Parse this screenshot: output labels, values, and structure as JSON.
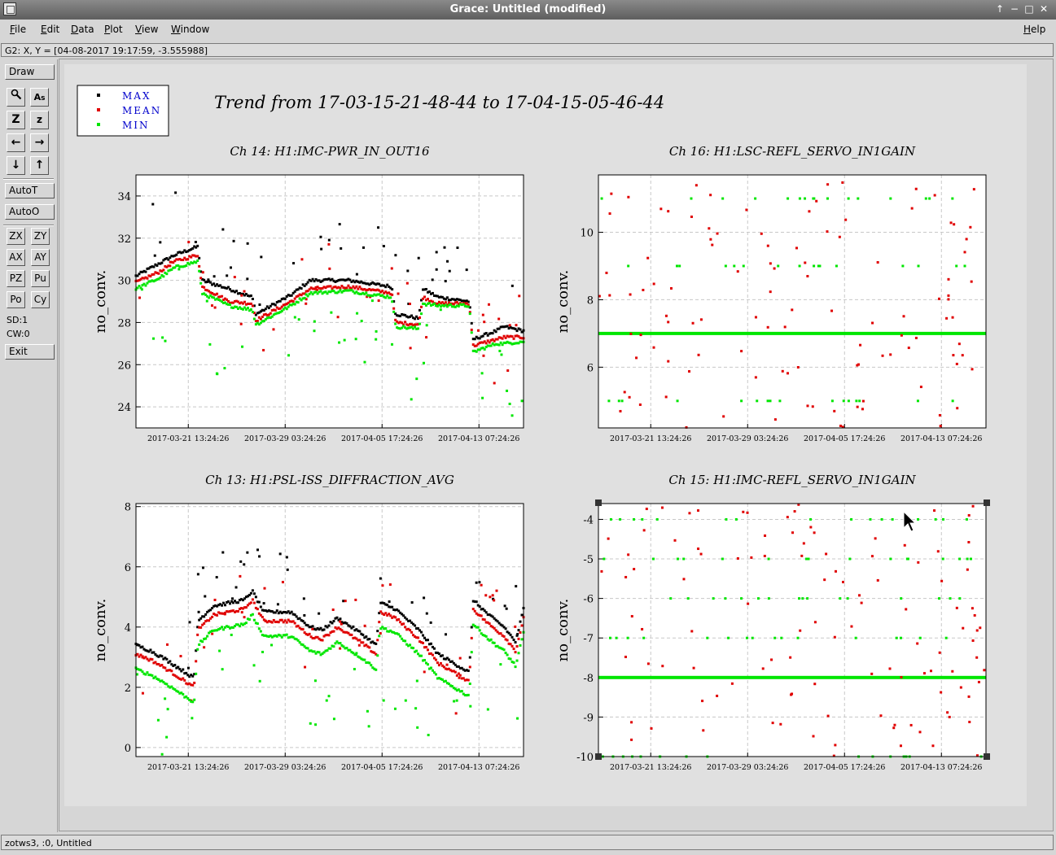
{
  "window": {
    "title": "Grace: Untitled (modified)"
  },
  "menubar": {
    "file": "File",
    "edit": "Edit",
    "data": "Data",
    "plot": "Plot",
    "view": "View",
    "window": "Window",
    "help": "Help"
  },
  "locator": "G2: X, Y = [04-08-2017 19:17:59, -3.555988]",
  "toolbar": {
    "draw": "Draw",
    "autot": "AutoT",
    "autoo": "AutoO",
    "zx": "ZX",
    "zy": "ZY",
    "ax": "AX",
    "ay": "AY",
    "pz": "PZ",
    "pu": "Pu",
    "po": "Po",
    "cy": "Cy",
    "sd": "SD:1",
    "cw": "CW:0",
    "exit": "Exit"
  },
  "status": "zotws3, :0, Untitled",
  "plot": {
    "title": "Trend from 17-03-15-21-48-44 to 17-04-15-05-46-44",
    "legend": [
      {
        "label": "MAX",
        "color": "#000000"
      },
      {
        "label": "MEAN",
        "color": "#ff0000"
      },
      {
        "label": "MIN",
        "color": "#00ff00"
      }
    ],
    "colors": {
      "max": "#000000",
      "mean": "#e00000",
      "min": "#00e600",
      "legend_text": "#0000cc"
    }
  },
  "chart_data": [
    {
      "type": "scatter",
      "title": "Ch 14: H1:IMC-PWR_IN_OUT16",
      "ylabel": "no_conv.",
      "ylim": [
        23,
        35
      ],
      "yticks": [
        "24",
        "26",
        "28",
        "30",
        "32",
        "34"
      ],
      "xticks": [
        "2017-03-21 13:24:26",
        "2017-03-29 03:24:26",
        "2017-04-05 17:24:26",
        "2017-04-13 07:24:26"
      ],
      "series": [
        {
          "name": "MAX",
          "trend": [
            [
              0,
              30.2
            ],
            [
              0.06,
              30.8
            ],
            [
              0.1,
              31.2
            ],
            [
              0.16,
              31.6
            ],
            [
              0.17,
              30.0
            ],
            [
              0.24,
              29.6
            ],
            [
              0.3,
              29.2
            ],
            [
              0.31,
              28.4
            ],
            [
              0.4,
              29.3
            ],
            [
              0.45,
              30.0
            ],
            [
              0.55,
              30.0
            ],
            [
              0.62,
              29.8
            ],
            [
              0.66,
              29.7
            ],
            [
              0.67,
              28.4
            ],
            [
              0.73,
              28.2
            ],
            [
              0.74,
              29.6
            ],
            [
              0.78,
              29.2
            ],
            [
              0.86,
              29.0
            ],
            [
              0.87,
              27.2
            ],
            [
              0.93,
              27.6
            ],
            [
              0.95,
              27.8
            ],
            [
              1.0,
              27.6
            ]
          ]
        },
        {
          "name": "MEAN",
          "trend": [
            [
              0,
              29.9
            ],
            [
              0.06,
              30.4
            ],
            [
              0.1,
              30.9
            ],
            [
              0.16,
              31.2
            ],
            [
              0.17,
              29.7
            ],
            [
              0.24,
              29.0
            ],
            [
              0.3,
              28.9
            ],
            [
              0.31,
              28.1
            ],
            [
              0.4,
              29.0
            ],
            [
              0.45,
              29.6
            ],
            [
              0.55,
              29.7
            ],
            [
              0.62,
              29.5
            ],
            [
              0.66,
              29.4
            ],
            [
              0.67,
              28.0
            ],
            [
              0.73,
              27.9
            ],
            [
              0.74,
              29.2
            ],
            [
              0.78,
              28.9
            ],
            [
              0.86,
              28.9
            ],
            [
              0.87,
              26.9
            ],
            [
              0.93,
              27.2
            ],
            [
              0.95,
              27.3
            ],
            [
              1.0,
              27.3
            ]
          ]
        },
        {
          "name": "MIN",
          "trend": [
            [
              0,
              29.6
            ],
            [
              0.06,
              30.1
            ],
            [
              0.1,
              30.6
            ],
            [
              0.16,
              30.9
            ],
            [
              0.17,
              29.4
            ],
            [
              0.24,
              28.8
            ],
            [
              0.3,
              28.6
            ],
            [
              0.31,
              27.9
            ],
            [
              0.4,
              28.8
            ],
            [
              0.45,
              29.4
            ],
            [
              0.55,
              29.5
            ],
            [
              0.62,
              29.3
            ],
            [
              0.66,
              29.2
            ],
            [
              0.67,
              27.8
            ],
            [
              0.73,
              27.7
            ],
            [
              0.74,
              28.9
            ],
            [
              0.78,
              28.8
            ],
            [
              0.86,
              28.8
            ],
            [
              0.87,
              26.6
            ],
            [
              0.93,
              27.0
            ],
            [
              0.95,
              27.0
            ],
            [
              1.0,
              27.1
            ]
          ]
        }
      ]
    },
    {
      "type": "scatter",
      "title": "Ch 16: H1:LSC-REFL_SERVO_IN1GAIN",
      "ylabel": "no_conv.",
      "ylim": [
        4.2,
        11.7
      ],
      "yticks": [
        "6",
        "8",
        "10"
      ],
      "xticks": [
        "2017-03-21 13:24:26",
        "2017-03-29 03:24:26",
        "2017-04-05 17:24:26",
        "2017-04-13 07:24:26"
      ],
      "series": [
        {
          "name": "MAX",
          "trend": [
            [
              0,
              7.0
            ],
            [
              1,
              7.0
            ]
          ]
        },
        {
          "name": "MEAN",
          "trend": [
            [
              0,
              7.0
            ],
            [
              1,
              7.0
            ]
          ]
        },
        {
          "name": "MIN",
          "trend": [
            [
              0,
              7.0
            ],
            [
              1,
              7.0
            ]
          ]
        }
      ]
    },
    {
      "type": "scatter",
      "title": "Ch 13: H1:PSL-ISS_DIFFRACTION_AVG",
      "ylabel": "no_conv.",
      "ylim": [
        -0.3,
        8.1
      ],
      "yticks": [
        "0",
        "2",
        "4",
        "6",
        "8"
      ],
      "xticks": [
        "2017-03-21 13:24:26",
        "2017-03-29 03:24:26",
        "2017-04-05 17:24:26",
        "2017-04-13 07:24:26"
      ],
      "series": [
        {
          "name": "MAX",
          "trend": [
            [
              0,
              3.4
            ],
            [
              0.04,
              3.2
            ],
            [
              0.08,
              2.9
            ],
            [
              0.15,
              2.3
            ],
            [
              0.16,
              4.2
            ],
            [
              0.2,
              4.7
            ],
            [
              0.28,
              4.9
            ],
            [
              0.3,
              5.2
            ],
            [
              0.33,
              4.5
            ],
            [
              0.4,
              4.5
            ],
            [
              0.45,
              4.0
            ],
            [
              0.48,
              3.9
            ],
            [
              0.52,
              4.3
            ],
            [
              0.58,
              3.8
            ],
            [
              0.62,
              3.4
            ],
            [
              0.63,
              4.8
            ],
            [
              0.67,
              4.6
            ],
            [
              0.73,
              3.9
            ],
            [
              0.78,
              3.1
            ],
            [
              0.86,
              2.5
            ],
            [
              0.87,
              4.9
            ],
            [
              0.91,
              4.4
            ],
            [
              0.95,
              4.0
            ],
            [
              0.98,
              3.5
            ],
            [
              1.0,
              4.6
            ]
          ]
        },
        {
          "name": "MEAN",
          "trend": [
            [
              0,
              3.1
            ],
            [
              0.04,
              2.9
            ],
            [
              0.08,
              2.6
            ],
            [
              0.15,
              2.0
            ],
            [
              0.16,
              3.9
            ],
            [
              0.2,
              4.4
            ],
            [
              0.28,
              4.6
            ],
            [
              0.3,
              4.9
            ],
            [
              0.33,
              4.2
            ],
            [
              0.4,
              4.2
            ],
            [
              0.45,
              3.7
            ],
            [
              0.48,
              3.6
            ],
            [
              0.52,
              4.0
            ],
            [
              0.58,
              3.5
            ],
            [
              0.62,
              3.1
            ],
            [
              0.63,
              4.5
            ],
            [
              0.67,
              4.3
            ],
            [
              0.73,
              3.6
            ],
            [
              0.78,
              2.8
            ],
            [
              0.86,
              2.2
            ],
            [
              0.87,
              4.6
            ],
            [
              0.91,
              4.1
            ],
            [
              0.95,
              3.7
            ],
            [
              0.98,
              3.2
            ],
            [
              1.0,
              4.3
            ]
          ]
        },
        {
          "name": "MIN",
          "trend": [
            [
              0,
              2.6
            ],
            [
              0.04,
              2.4
            ],
            [
              0.08,
              2.1
            ],
            [
              0.15,
              1.5
            ],
            [
              0.16,
              3.4
            ],
            [
              0.2,
              3.9
            ],
            [
              0.28,
              4.1
            ],
            [
              0.3,
              4.4
            ],
            [
              0.33,
              3.7
            ],
            [
              0.4,
              3.7
            ],
            [
              0.45,
              3.2
            ],
            [
              0.48,
              3.1
            ],
            [
              0.52,
              3.5
            ],
            [
              0.58,
              3.0
            ],
            [
              0.62,
              2.6
            ],
            [
              0.63,
              4.0
            ],
            [
              0.67,
              3.8
            ],
            [
              0.73,
              3.1
            ],
            [
              0.78,
              2.3
            ],
            [
              0.86,
              1.7
            ],
            [
              0.87,
              4.1
            ],
            [
              0.91,
              3.6
            ],
            [
              0.95,
              3.2
            ],
            [
              0.98,
              2.7
            ],
            [
              1.0,
              3.8
            ]
          ]
        }
      ]
    },
    {
      "type": "scatter",
      "title": "Ch 15: H1:IMC-REFL_SERVO_IN1GAIN",
      "ylabel": "no_conv.",
      "ylim": [
        -10,
        -3.6
      ],
      "yticks": [
        "-4",
        "-5",
        "-6",
        "-7",
        "-8",
        "-9",
        "-10"
      ],
      "xticks": [
        "2017-03-21 13:24:26",
        "2017-03-29 03:24:26",
        "2017-04-05 17:24:26",
        "2017-04-13 07:24:26"
      ],
      "series": [
        {
          "name": "MAX",
          "trend": [
            [
              0,
              -8
            ],
            [
              1,
              -8
            ]
          ]
        },
        {
          "name": "MEAN",
          "trend": [
            [
              0,
              -8
            ],
            [
              1,
              -8
            ]
          ]
        },
        {
          "name": "MIN",
          "trend": [
            [
              0,
              -8
            ],
            [
              1,
              -8
            ]
          ]
        }
      ]
    }
  ]
}
